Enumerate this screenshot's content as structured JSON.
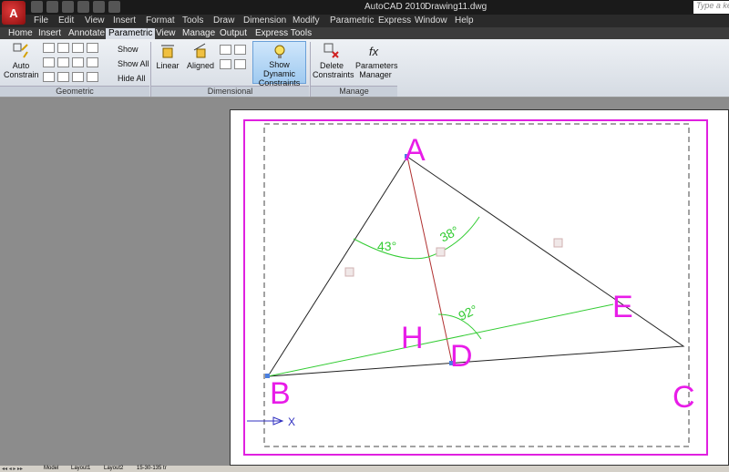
{
  "titlebar": {
    "app_title": "AutoCAD 2010",
    "doc_title": "Drawing11.dwg",
    "search_placeholder": "Type a keyword"
  },
  "menu": {
    "items": [
      "File",
      "Edit",
      "View",
      "Insert",
      "Format",
      "Tools",
      "Draw",
      "Dimension",
      "Modify",
      "Parametric",
      "Express",
      "Window",
      "Help"
    ]
  },
  "tabs": {
    "items": [
      "Home",
      "Insert",
      "Annotate",
      "Parametric",
      "View",
      "Manage",
      "Output",
      "Express Tools"
    ],
    "active": "Parametric"
  },
  "ribbon": {
    "auto_constrain": "Auto Constrain",
    "show": "Show",
    "show_all": "Show All",
    "hide_all": "Hide All",
    "linear": "Linear",
    "aligned": "Aligned",
    "show_dynamic": "Show Dynamic Constraints",
    "delete_constraints": "Delete Constraints",
    "parameters_manager": "Parameters Manager",
    "panel_geometric": "Geometric",
    "panel_dimensional": "Dimensional",
    "panel_manage": "Manage"
  },
  "drawing": {
    "labels": {
      "a": "A",
      "b": "B",
      "c": "C",
      "d": "D",
      "e": "E",
      "h": "H"
    },
    "angles": {
      "a1": "43°",
      "a2": "38°",
      "a3": "92°"
    },
    "ucs_x": "X",
    "colors": {
      "border": "#e020e0",
      "label": "#e81ce8",
      "green": "#33cc33",
      "red_line": "#b03030"
    }
  },
  "status": {
    "tabs": [
      "Model",
      "Layout1",
      "Layout2",
      "15-30-135 tr"
    ]
  }
}
